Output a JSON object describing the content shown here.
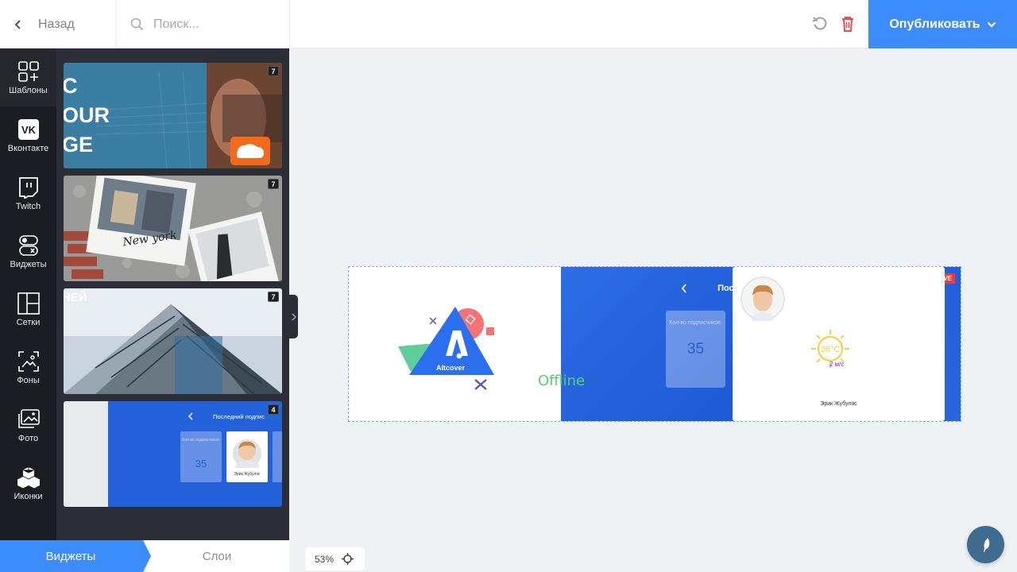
{
  "header": {
    "back_label": "Назад",
    "search_placeholder": "Поиск...",
    "publish_label": "Опубликовать"
  },
  "sidebar": {
    "items": [
      {
        "label": "Шаблоны",
        "icon": "templates-icon"
      },
      {
        "label": "Вконтакте",
        "icon": "vk-icon"
      },
      {
        "label": "Twitch",
        "icon": "twitch-icon"
      },
      {
        "label": "Виджеты",
        "icon": "widgets-icon"
      },
      {
        "label": "Сетки",
        "icon": "grid-icon"
      },
      {
        "label": "Фоны",
        "icon": "background-icon"
      },
      {
        "label": "Фото",
        "icon": "photo-icon"
      },
      {
        "label": "Иконки",
        "icon": "icons-icon"
      }
    ]
  },
  "templates": [
    {
      "count": "7",
      "text": "C\nOUR\nGE"
    },
    {
      "count": "7",
      "text": "New york"
    },
    {
      "count": "7",
      "text": "НЕЙ"
    },
    {
      "count": "4",
      "text": "Последний подпис",
      "label": "Кол-во подписчиков:",
      "number": "35",
      "name": "Эрик Жубуляс"
    }
  ],
  "tabs": {
    "widgets": "Виджеты",
    "layers": "Слои"
  },
  "zoom": {
    "value": "53%"
  },
  "banner": {
    "brand": "Altcover",
    "offline": "Offline",
    "live": "LIVE",
    "title": "Последний подписчик",
    "subscribers_label": "Кол-во подписчиков:",
    "subscribers_count": "35",
    "subscriber_name": "Эрик Жубуляс",
    "temperature": "36°C",
    "wind": "2 м/с"
  },
  "colors": {
    "accent": "#3d8cfb",
    "banner_blue": "#2563e0",
    "offline": "#5ecc73",
    "live": "#f23b3b"
  }
}
